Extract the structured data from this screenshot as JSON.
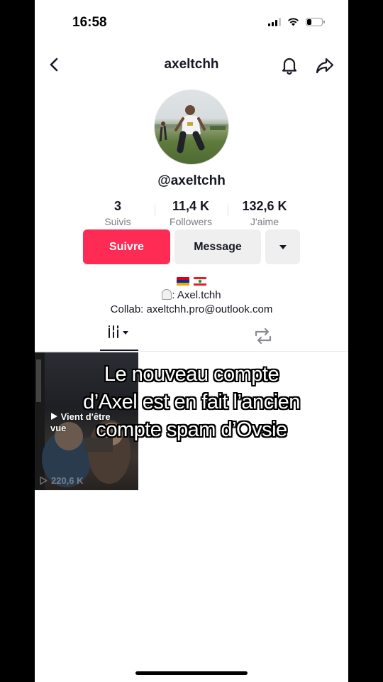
{
  "status_bar": {
    "time": "16:58",
    "battery_level": 0.3
  },
  "header": {
    "title": "axeltchh"
  },
  "profile": {
    "handle": "@axeltchh",
    "stats": [
      {
        "value": "3",
        "label": "Suivis"
      },
      {
        "value": "11,4 K",
        "label": "Followers"
      },
      {
        "value": "132,6 K",
        "label": "J'aime"
      }
    ],
    "buttons": {
      "follow": "Suivre",
      "message": "Message"
    },
    "bio": {
      "line2": ": Axel.tchh",
      "line3": "Collab: axeltchh.pro@outlook.com"
    }
  },
  "videos": [
    {
      "pinned_label": "Vient d'être vue",
      "views": "220,6 K"
    }
  ],
  "overlay_caption": {
    "line1": "Le nouveau compte",
    "line2": "d’Axel est en fait l’ancien",
    "line3": "compte spam d’Ovsie"
  },
  "colors": {
    "accent": "#fe2c55",
    "secondary_button": "#efeff0",
    "text": "#161823",
    "muted": "#7a7b81"
  },
  "icons": [
    "back-icon",
    "bell-icon",
    "share-icon",
    "chevron-down-icon",
    "grid-videos-icon",
    "repost-icon",
    "play-icon"
  ]
}
